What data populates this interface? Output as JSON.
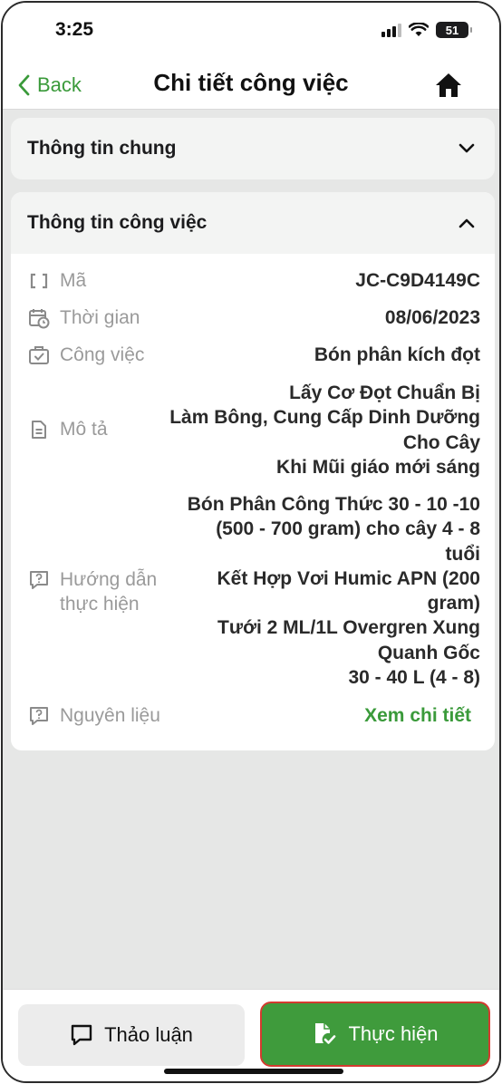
{
  "status_bar": {
    "time": "3:25",
    "battery": "51"
  },
  "nav": {
    "back_label": "Back",
    "title": "Chi tiết công việc"
  },
  "sections": {
    "general": {
      "title": "Thông tin chung"
    },
    "work": {
      "title": "Thông tin công việc"
    }
  },
  "details": {
    "code": {
      "label": "Mã",
      "value": "JC-C9D4149C"
    },
    "time": {
      "label": "Thời gian",
      "value": "08/06/2023"
    },
    "job": {
      "label": "Công việc",
      "value": "Bón phân kích đọt"
    },
    "description": {
      "label": "Mô tả",
      "lines": [
        "Lấy Cơ Đọt Chuẩn Bị",
        "Làm Bông, Cung Cấp Dinh Dưỡng",
        "Cho Cây",
        "Khi Mũi giáo mới sáng"
      ]
    },
    "instructions": {
      "label_lines": [
        "Hướng dẫn",
        "thực hiện"
      ],
      "lines": [
        "Bón Phân Công Thức 30 - 10 -10",
        "(500 - 700 gram) cho cây 4 - 8",
        "tuổi",
        "Kết Hợp Vơi Humic APN (200",
        "gram)",
        "Tưới 2 ML/1L Overgren Xung",
        "Quanh Gốc",
        "30 - 40 L (4 - 8)"
      ]
    },
    "materials": {
      "label": "Nguyên liệu",
      "link": "Xem chi tiết"
    }
  },
  "actions": {
    "discuss_label": "Thảo luận",
    "perform_label": "Thực hiện"
  },
  "icons": {
    "back": "chevron-left-icon",
    "home": "home-icon",
    "collapse": "chevron-down-icon",
    "expand": "chevron-up-icon",
    "code": "brackets-icon",
    "time": "calendar-clock-icon",
    "job": "briefcase-check-icon",
    "description": "document-icon",
    "instructions": "help-message-icon",
    "materials": "help-message-icon",
    "discuss": "chat-bubble-icon",
    "perform": "file-check-icon"
  },
  "colors": {
    "accent": "#3f9b3c",
    "link": "#3a9a3a",
    "highlight_border": "#d43a2f"
  }
}
